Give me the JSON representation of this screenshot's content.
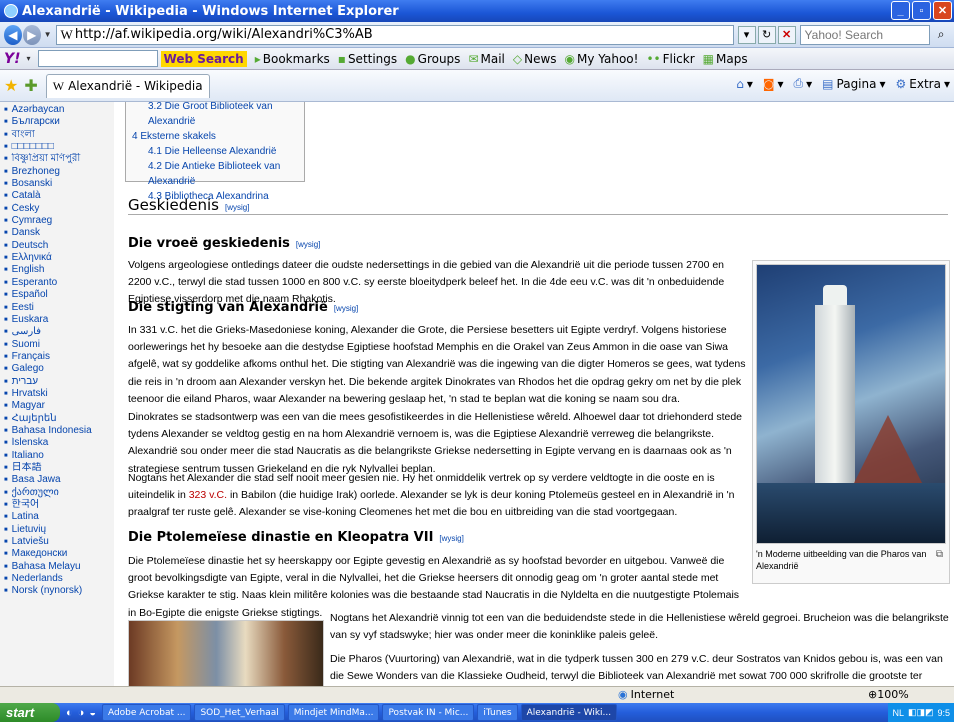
{
  "window": {
    "title": "Alexandrië - Wikipedia - Windows Internet Explorer"
  },
  "addressbar": {
    "url": "http://af.wikipedia.org/wiki/Alexandri%C3%AB",
    "search_placeholder": "Yahoo! Search"
  },
  "yahoo_toolbar": {
    "logo": "Y!",
    "web_search": "Web Search",
    "items": [
      "Bookmarks",
      "Settings",
      "Groups",
      "Mail",
      "News",
      "My Yahoo!",
      "Flickr",
      "Maps"
    ]
  },
  "tab": {
    "title": "Alexandrië - Wikipedia"
  },
  "commands": {
    "page": "Pagina",
    "extra": "Extra"
  },
  "sidebar": {
    "languages": [
      "Azərbaycan",
      "Български",
      "বাংলা",
      "□□□□□□□",
      "বিষ্ণুপ্রিয়া মণিপুরী",
      "Brezhoneg",
      "Bosanski",
      "Català",
      "Česky",
      "Cymraeg",
      "Dansk",
      "Deutsch",
      "Ελληνικά",
      "English",
      "Esperanto",
      "Español",
      "Eesti",
      "Euskara",
      "فارسی",
      "Suomi",
      "Français",
      "Galego",
      "עברית",
      "Hrvatski",
      "Magyar",
      "Հայերեն",
      "Bahasa Indonesia",
      "Íslenska",
      "Italiano",
      "日本語",
      "Basa Jawa",
      "ქართული",
      "한국어",
      "Latina",
      "Lietuvių",
      "Latviešu",
      "Македонски",
      "Bahasa Melayu",
      "Nederlands",
      "Norsk (nynorsk)"
    ]
  },
  "toc": {
    "items": [
      {
        "text": "3.2 Die Groot Biblioteek van Alexandrië",
        "level": 2
      },
      {
        "text": "4 Eksterne skakels",
        "level": 1
      },
      {
        "text": "4.1 Die Helleense Alexandrië",
        "level": 2
      },
      {
        "text": "4.2 Die Antieke Biblioteek van Alexandrië",
        "level": 2
      },
      {
        "text": "4.3 Bibliotheca Alexandrina",
        "level": 2
      }
    ]
  },
  "content": {
    "edit_label": "[wysig]",
    "h_geskiedenis": "Geskiedenis",
    "h_vroee": "Die vroeë geskiedenis",
    "p_vroee": "Volgens argeologiese ontledings dateer die oudste nedersettings in die gebied van die Alexandrië uit die periode tussen 2700 en 2200 v.C., terwyl die stad tussen 1000 en 800 v.C. sy eerste bloeitydperk beleef het. In die 4de eeu v.C. was dit 'n onbeduidende Egiptiese visserdorp met die naam Rhakotis.",
    "h_stigting": "Die stigting van Alexandrië",
    "p_stigting1": "In 331 v.C. het die Grieks-Masedoniese koning, Alexander die Grote, die Persiese besetters uit Egipte verdryf. Volgens historiese oorlewerings het hy besoeke aan die destydse Egiptiese hoofstad Memphis en die Orakel van Zeus Ammon in die oase van Siwa afgelê, wat sy goddelike afkoms onthul het. Die stigting van Alexandrië was die ingewing van die digter Homeros se gees, wat tydens die reis in 'n droom aan Alexander verskyn het. Die bekende argitek Dinokrates van Rhodos het die opdrag gekry om net by die plek teenoor die eiland Pharos, waar Alexander na bewering geslaap het, 'n stad te beplan wat die koning se naam sou dra.",
    "p_stigting2": "Dinokrates se stadsontwerp was een van die mees gesofistikeerdes in die Hellenistiese wêreld. Alhoewel daar tot driehonderd stede tydens Alexander se veldtog gestig en na hom Alexandrië vernoem is, was die Egiptiese Alexandrië verreweg die belangrikste. Alexandrië sou onder meer die stad Naucratis as die belangrikste Griekse nedersetting in Egipte vervang en is daarnaas ook as 'n strategiese sentrum tussen Griekeland en die ryk Nylvallei beplan.",
    "p_stigting3_a": "Nogtans het Alexander die stad self nooit meer gesien nie. Hy het onmiddelik vertrek op sy verdere veldtogte in die ooste en is uiteindelik in ",
    "p_stigting3_link": "323 v.C.",
    "p_stigting3_b": " in Babilon (die huidige Irak) oorlede. Alexander se lyk is deur koning Ptolemeüs gesteel en in Alexandrië in 'n praalgraf ter ruste gelê. Alexander se vise-koning Cleomenes het met die bou en uitbreiding van die stad voortgegaan.",
    "h_ptolemeiese": "Die Ptolemeïese dinastie en Kleopatra VII",
    "p_ptolemeiese": "Die Ptolemeïese dinastie het sy heerskappy oor Egipte gevestig en Alexandrië as sy hoofstad bevorder en uitgebou. Vanweë die groot bevolkingsdigte van Egipte, veral in die Nylvallei, het die Griekse heersers dit onnodig geag om 'n groter aantal stede met Griekse karakter te stig. Naas klein militêre kolonies was die bestaande stad Naucratis in die Nyldelta en die nuutgestigte Ptolemais in Bo-Egipte die enigste Griekse stigtings.",
    "p_nogtans": "Nogtans het Alexandrië vinnig tot een van die beduidendste stede in die Hellenistiese wêreld gegroei. Brucheion was die belangrikste van sy vyf stadswyke; hier was onder meer die koninklike paleis geleë.",
    "p_pharos": "Die Pharos (Vuurtoring) van Alexandrië, wat in die tydperk tussen 300 en 279 v.C. deur Sostratos van Knidos gebou is, was een van die Sewe Wonders van die Klassieke Oudheid, terwyl die Biblioteek van Alexandrië met sowat 700 000 skrifrolle die grootste ter wêreld was. Twee seehawens het Alexandrië",
    "thumb_caption": "'n Moderne uitbeelding van die Pharos van Alexandrië"
  },
  "statusbar": {
    "zone": "Internet",
    "zoom": "100%"
  },
  "taskbar": {
    "start": "start",
    "tasks": [
      "Adobe Acrobat ...",
      "SOD_Het_Verhaal",
      "Mindjet MindMa...",
      "Postvak IN - Mic...",
      "iTunes",
      "Alexandrië - Wiki..."
    ],
    "tray": "NL",
    "clock": "9:5"
  }
}
